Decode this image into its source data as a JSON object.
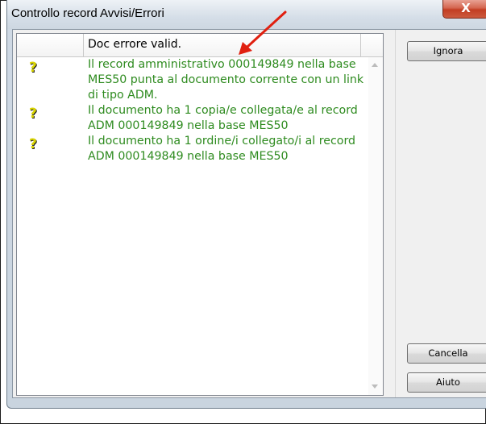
{
  "window": {
    "title": "Controllo record Avvisi/Errori",
    "close_label": "X"
  },
  "list": {
    "column_header": "Doc errore valid.",
    "rows": [
      {
        "icon": "question-mark-icon",
        "text": "Il record amministrativo 000149849 nella base MES50 punta al documento corrente con un link di tipo ADM."
      },
      {
        "icon": "question-mark-icon",
        "text": "Il documento ha 1 copia/e collegata/e al record ADM 000149849 nella base MES50"
      },
      {
        "icon": "question-mark-icon",
        "text": "Il documento ha 1 ordine/i collegato/i al record ADM 000149849 nella base MES50"
      }
    ]
  },
  "buttons": {
    "ignore": "Ignora",
    "cancel": "Cancella",
    "help": "Aiuto"
  },
  "colors": {
    "message_text": "#2e8b1f",
    "annotation_arrow": "#e02010",
    "close_button": "#c8452b"
  }
}
